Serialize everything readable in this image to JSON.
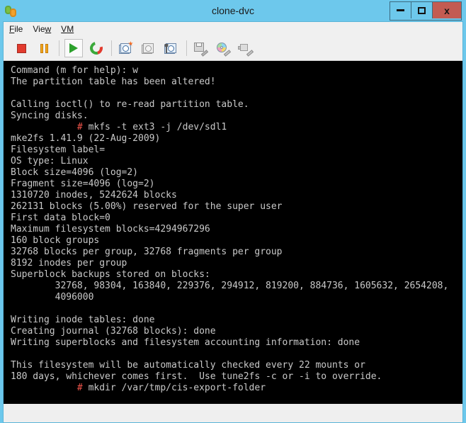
{
  "window": {
    "title": "clone-dvc",
    "icon": "vm-console-icon",
    "controls": {
      "minimize_label": "–",
      "maximize_label": "□",
      "close_label": "x"
    },
    "colors": {
      "titlebar": "#6dc8ec",
      "close_button": "#c35b52",
      "chrome": "#f0f0f0",
      "terminal_bg": "#000000",
      "terminal_fg": "#c9c9c9",
      "prompt_red": "#f2554b"
    }
  },
  "menubar": {
    "items": [
      {
        "label": "File",
        "accel_index": 0
      },
      {
        "label": "View",
        "accel_index": 3
      },
      {
        "label": "VM",
        "accel_index": 0
      }
    ]
  },
  "toolbar": {
    "buttons": [
      {
        "name": "power-off-button",
        "icon": "stop-icon",
        "title": "Power Off",
        "enabled": true,
        "active": false
      },
      {
        "name": "suspend-button",
        "icon": "pause-icon",
        "title": "Suspend",
        "enabled": true,
        "active": false
      },
      {
        "name": "power-on-button",
        "icon": "play-icon",
        "title": "Power On",
        "enabled": true,
        "active": true
      },
      {
        "name": "reset-button",
        "icon": "reset-circular-arrows-icon",
        "title": "Reset",
        "enabled": true,
        "active": false
      },
      {
        "name": "take-snapshot-button",
        "icon": "snapshot-add-icon",
        "title": "Take Snapshot",
        "enabled": true,
        "active": false
      },
      {
        "name": "revert-snapshot-button",
        "icon": "snapshot-revert-icon",
        "title": "Revert to Snapshot",
        "enabled": false,
        "active": false
      },
      {
        "name": "snapshot-manager-button",
        "icon": "snapshot-manager-wrench-icon",
        "title": "Manage Snapshots",
        "enabled": true,
        "active": false
      },
      {
        "name": "connect-floppy-button",
        "icon": "floppy-disk-icon",
        "title": "Floppy Drive",
        "enabled": false,
        "active": false
      },
      {
        "name": "connect-cdrom-button",
        "icon": "cd-dvd-icon",
        "title": "CD/DVD Drive",
        "enabled": true,
        "active": false
      },
      {
        "name": "connect-usb-button",
        "icon": "usb-device-icon",
        "title": "USB Device",
        "enabled": false,
        "active": false
      }
    ]
  },
  "terminal": {
    "lines": [
      {
        "text": "Command (m for help): w"
      },
      {
        "text": "The partition table has been altered!"
      },
      {
        "text": ""
      },
      {
        "text": "Calling ioctl() to re-read partition table."
      },
      {
        "text": "Syncing disks."
      },
      {
        "prompt": "#",
        "indent": "            ",
        "text": " mkfs -t ext3 -j /dev/sdl1"
      },
      {
        "text": "mke2fs 1.41.9 (22-Aug-2009)"
      },
      {
        "text": "Filesystem label="
      },
      {
        "text": "OS type: Linux"
      },
      {
        "text": "Block size=4096 (log=2)"
      },
      {
        "text": "Fragment size=4096 (log=2)"
      },
      {
        "text": "1310720 inodes, 5242624 blocks"
      },
      {
        "text": "262131 blocks (5.00%) reserved for the super user"
      },
      {
        "text": "First data block=0"
      },
      {
        "text": "Maximum filesystem blocks=4294967296"
      },
      {
        "text": "160 block groups"
      },
      {
        "text": "32768 blocks per group, 32768 fragments per group"
      },
      {
        "text": "8192 inodes per group"
      },
      {
        "text": "Superblock backups stored on blocks:"
      },
      {
        "text": "        32768, 98304, 163840, 229376, 294912, 819200, 884736, 1605632, 2654208,"
      },
      {
        "text": "        4096000"
      },
      {
        "text": ""
      },
      {
        "text": "Writing inode tables: done"
      },
      {
        "text": "Creating journal (32768 blocks): done"
      },
      {
        "text": "Writing superblocks and filesystem accounting information: done"
      },
      {
        "text": ""
      },
      {
        "text": "This filesystem will be automatically checked every 22 mounts or"
      },
      {
        "text": "180 days, whichever comes first.  Use tune2fs -c or -i to override."
      },
      {
        "prompt": "#",
        "indent": "            ",
        "text": " mkdir /var/tmp/cis-export-folder"
      }
    ]
  }
}
